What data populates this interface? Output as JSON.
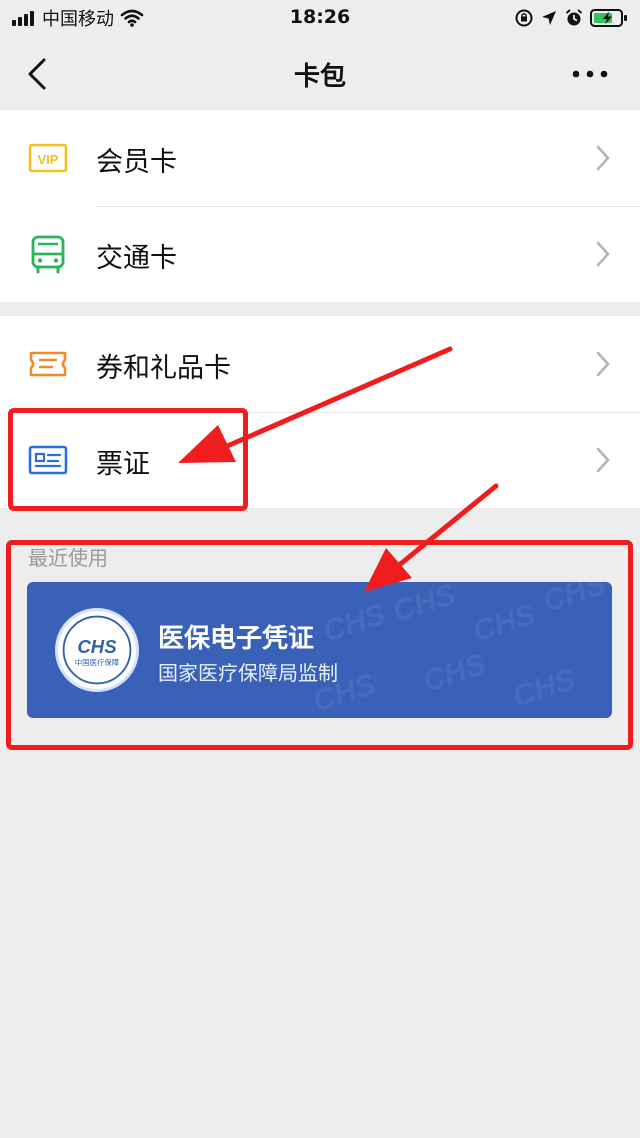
{
  "status_bar": {
    "carrier": "中国移动",
    "time": "18:26"
  },
  "nav": {
    "title": "卡包"
  },
  "menu": {
    "group1": [
      {
        "label": "会员卡",
        "icon": "vip-icon",
        "icon_text": "VIP",
        "color": "#f2c21b"
      },
      {
        "label": "交通卡",
        "icon": "bus-icon",
        "color": "#2bb45b"
      }
    ],
    "group2": [
      {
        "label": "券和礼品卡",
        "icon": "ticket-icon",
        "color": "#f08a2a"
      },
      {
        "label": "票证",
        "icon": "id-card-icon",
        "color": "#2a6fd6"
      }
    ]
  },
  "recent": {
    "label": "最近使用",
    "card": {
      "logo_text": "CHS",
      "logo_subtext": "中国医疗保障",
      "title": "医保电子凭证",
      "subtitle": "国家医疗保障局监制",
      "color": "#3a61b8"
    }
  },
  "annotation": {
    "color": "#ef1d1d"
  }
}
